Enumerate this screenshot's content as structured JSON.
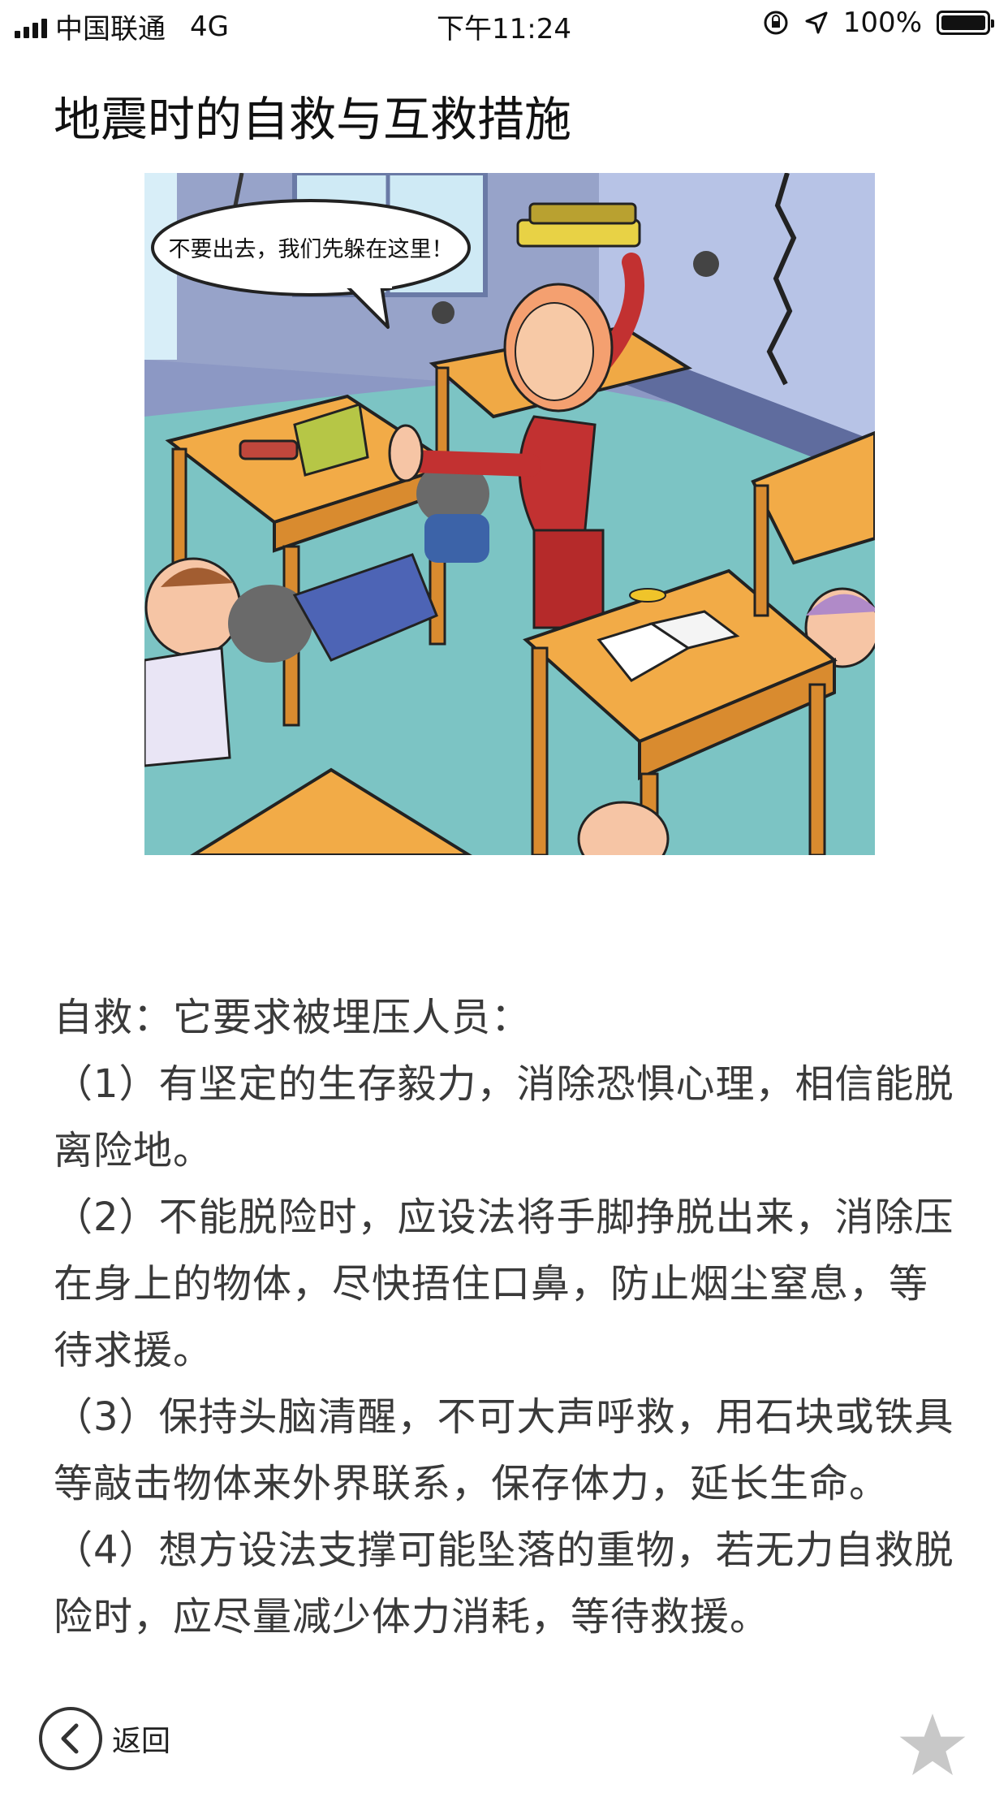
{
  "status_bar": {
    "carrier": "中国联通",
    "network": "4G",
    "time": "下午11:24",
    "battery_text": "100%",
    "battery_level": 1.0
  },
  "page": {
    "title": "地震时的自救与互救措施"
  },
  "illustration": {
    "speech_bubble": "不要出去，我们先躲在这里！"
  },
  "article": {
    "paragraphs": [
      "自救：它要求被埋压人员：",
      "（1）有坚定的生存毅力，消除恐惧心理，相信能脱离险地。",
      "（2）不能脱险时，应设法将手脚挣脱出来，消除压在身上的物体，尽快捂住口鼻，防止烟尘窒息，等待求援。",
      "（3）保持头脑清醒，不可大声呼救，用石块或铁具等敲击物体来外界联系，保存体力，延长生命。",
      "（4）想方设法支撑可能坠落的重物，若无力自救脱险时，应尽量减少体力消耗，等待救援。"
    ]
  },
  "bottom_bar": {
    "back_label": "返回",
    "icons": [
      "back-circle-icon",
      "star-icon"
    ]
  }
}
